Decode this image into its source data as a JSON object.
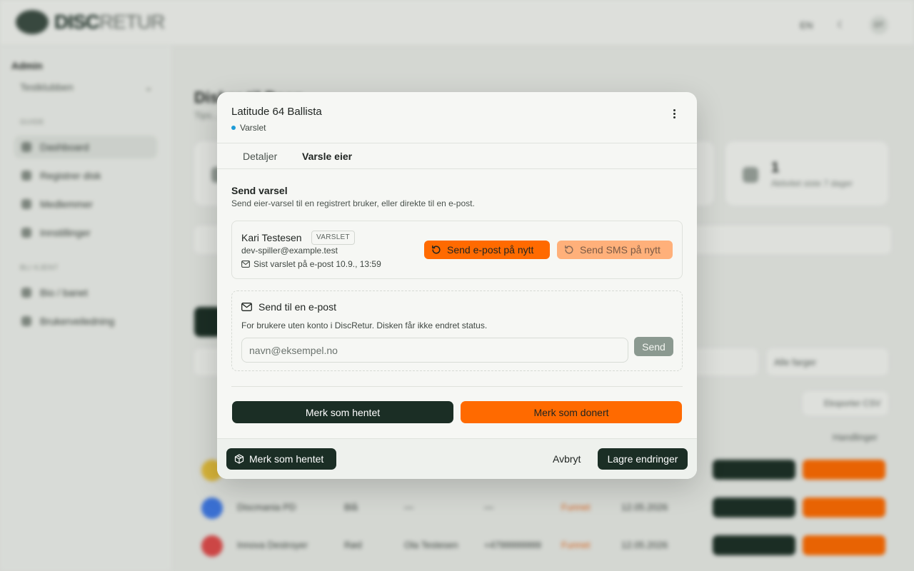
{
  "background": {
    "brand": {
      "logo_bold": "DISC",
      "logo_light": "RETUR"
    },
    "topbar": {
      "lang": "EN",
      "avatar": "DT"
    },
    "sidebar": {
      "heading": "Admin",
      "club_select": "Testklubben",
      "section_main": "GUIDE",
      "items_main": [
        "Dashboard",
        "Registrer disk",
        "Medlemmer",
        "Innstillinger"
      ],
      "section_other": "BLI KJENT",
      "items_other": [
        "Bio / banet",
        "Brukerveiledning"
      ]
    },
    "main": {
      "title": "Disker til Daan",
      "subtitle": "Tips..."
    },
    "stat": {
      "value": "1",
      "label": "Aktivitet siste 7 dager"
    },
    "filter": "Alle farger",
    "export": "Eksporter CSV",
    "actions_header": "Handlinger",
    "rows": [
      {
        "name": "",
        "color": "#e9c13b",
        "c1": "",
        "c2": "",
        "c3": "",
        "c4": "",
        "date": ""
      },
      {
        "name": "Discmania PD",
        "color": "#3e78e6",
        "c1": "Blå",
        "c2": "—",
        "c3": "—",
        "status": "Funnet",
        "date": "12.05.2026"
      },
      {
        "name": "Innova Destroyer",
        "color": "#e04a4a",
        "c1": "Rød",
        "c2": "Ola Testesen",
        "c3": "+4799999999",
        "status": "Funnet",
        "date": "12.05.2026"
      }
    ]
  },
  "modal": {
    "title": "Latitude 64 Ballista",
    "status": "Varslet",
    "status_color": "#1e9bd7",
    "tabs": [
      {
        "label": "Detaljer",
        "active": false
      },
      {
        "label": "Varsle eier",
        "active": true
      }
    ],
    "section_title": "Send varsel",
    "section_sub": "Send eier-varsel til en registrert bruker, eller direkte til en e-post.",
    "user": {
      "name": "Kari Testesen",
      "badge": "VARSLET",
      "email": "dev-spiller@example.test",
      "last_notified": "Sist varslet på e-post 10.9., 13:59"
    },
    "resend_email": "Send e-post på nytt",
    "resend_sms": "Send SMS på nytt",
    "email_section": {
      "title": "Send til en e-post",
      "description": "For brukere uten konto i DiscRetur. Disken får ikke endret status.",
      "placeholder": "navn@eksempel.no",
      "send": "Send"
    },
    "mark_collected": "Merk som hentet",
    "mark_donated": "Merk som donert",
    "footer": {
      "mark_collected": "Merk som hentet",
      "cancel": "Avbryt",
      "save": "Lagre endringer"
    },
    "colors": {
      "primary_dark": "#1b2e25",
      "accent_orange": "#ff6a00"
    }
  }
}
